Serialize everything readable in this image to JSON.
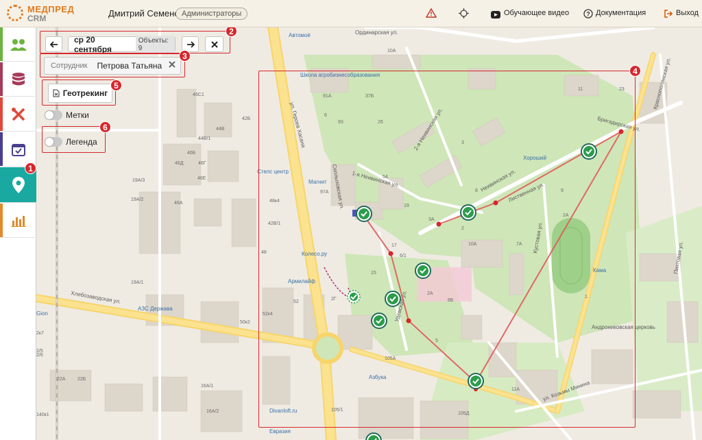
{
  "app": {
    "logo_line1": "МЕДПРЕД",
    "logo_line2": "CRM"
  },
  "header": {
    "user_name": "Дмитрий Семенов",
    "role_badge": "Администраторы",
    "links": [
      {
        "label": "Обучающее видео",
        "icon": "video-icon"
      },
      {
        "label": "Документация",
        "icon": "help-icon"
      },
      {
        "label": "Выход",
        "icon": "logout-icon"
      }
    ],
    "icons": [
      "warning-icon",
      "target-icon"
    ]
  },
  "sidebar": {
    "items": [
      {
        "icon": "users-icon",
        "color": "#6cb33f"
      },
      {
        "icon": "database-icon",
        "color": "#a53b5a"
      },
      {
        "icon": "tools-icon",
        "color": "#e0483a"
      },
      {
        "icon": "calendar-icon",
        "color": "#4a3f8f"
      },
      {
        "icon": "map-pin-icon",
        "color": "#19a9a1",
        "active": true
      },
      {
        "icon": "chart-icon",
        "color": "#e08a2a"
      }
    ]
  },
  "controls": {
    "date_label": "ср 20 сентября",
    "objects_label": "Объекты: 9",
    "employee_label": "Сотрудник",
    "employee_value": "Петрова Татьяна",
    "geotracking_label": "Геотрекинг",
    "labels_toggle": "Метки",
    "legend_toggle": "Легенда"
  },
  "annotations": [
    "1",
    "2",
    "3",
    "4",
    "5",
    "6"
  ],
  "map": {
    "streets": [
      "ул. Героев Хасана",
      "Хлебозаводская ул.",
      "Сеплыховская ул.",
      "1-я Неивинская ул.",
      "2-я Неивинская ул.",
      "Неивинская ул.",
      "Лиственная ул.",
      "Бригадирская ул.",
      "Краснополянская ул.",
      "Кустовая ул.",
      "Удевская ул.",
      "ул. Козьмы Минина",
      "Пихтовая ул.",
      "Ординарская ул."
    ],
    "pois": [
      "Автомоё",
      "Школа агробизнесобразования",
      "Стелс центр",
      "Магнит",
      "Хороший",
      "Колесо.ру",
      "Армилайф",
      "АЗС Держава",
      "Кама",
      "Андрониковская церковь",
      "Азбука",
      "Divanloft.ru",
      "Евразия",
      "Gion"
    ],
    "houses": [
      "10А",
      "91А",
      "37Б",
      "93",
      "26",
      "11",
      "23",
      "97А",
      "19",
      "3А",
      "10А",
      "7А",
      "17",
      "15",
      "2А",
      "9",
      "54",
      "52",
      "52к4",
      "50к2",
      "48",
      "48к4",
      "42В/1",
      "46С1",
      "42Б",
      "44В",
      "44В/1",
      "46Б",
      "46Г",
      "46Д",
      "46Е",
      "46А",
      "19А/3",
      "19А/2",
      "19А/1",
      "16А/1",
      "16А/2",
      "22А",
      "22Б",
      "140к1",
      "2/5",
      "2/6",
      "2к7",
      "105А",
      "105/1",
      "105Д",
      "11А",
      "5",
      "2",
      "3",
      "8",
      "6",
      "1",
      "2Г",
      "2В",
      "6/1",
      "8Б",
      "2А"
    ],
    "route_markers": 9
  },
  "colors": {
    "accent": "#19a9a1",
    "annotation": "#d6262c",
    "route": "#e05a5a",
    "marker": "#2a9d4a"
  }
}
